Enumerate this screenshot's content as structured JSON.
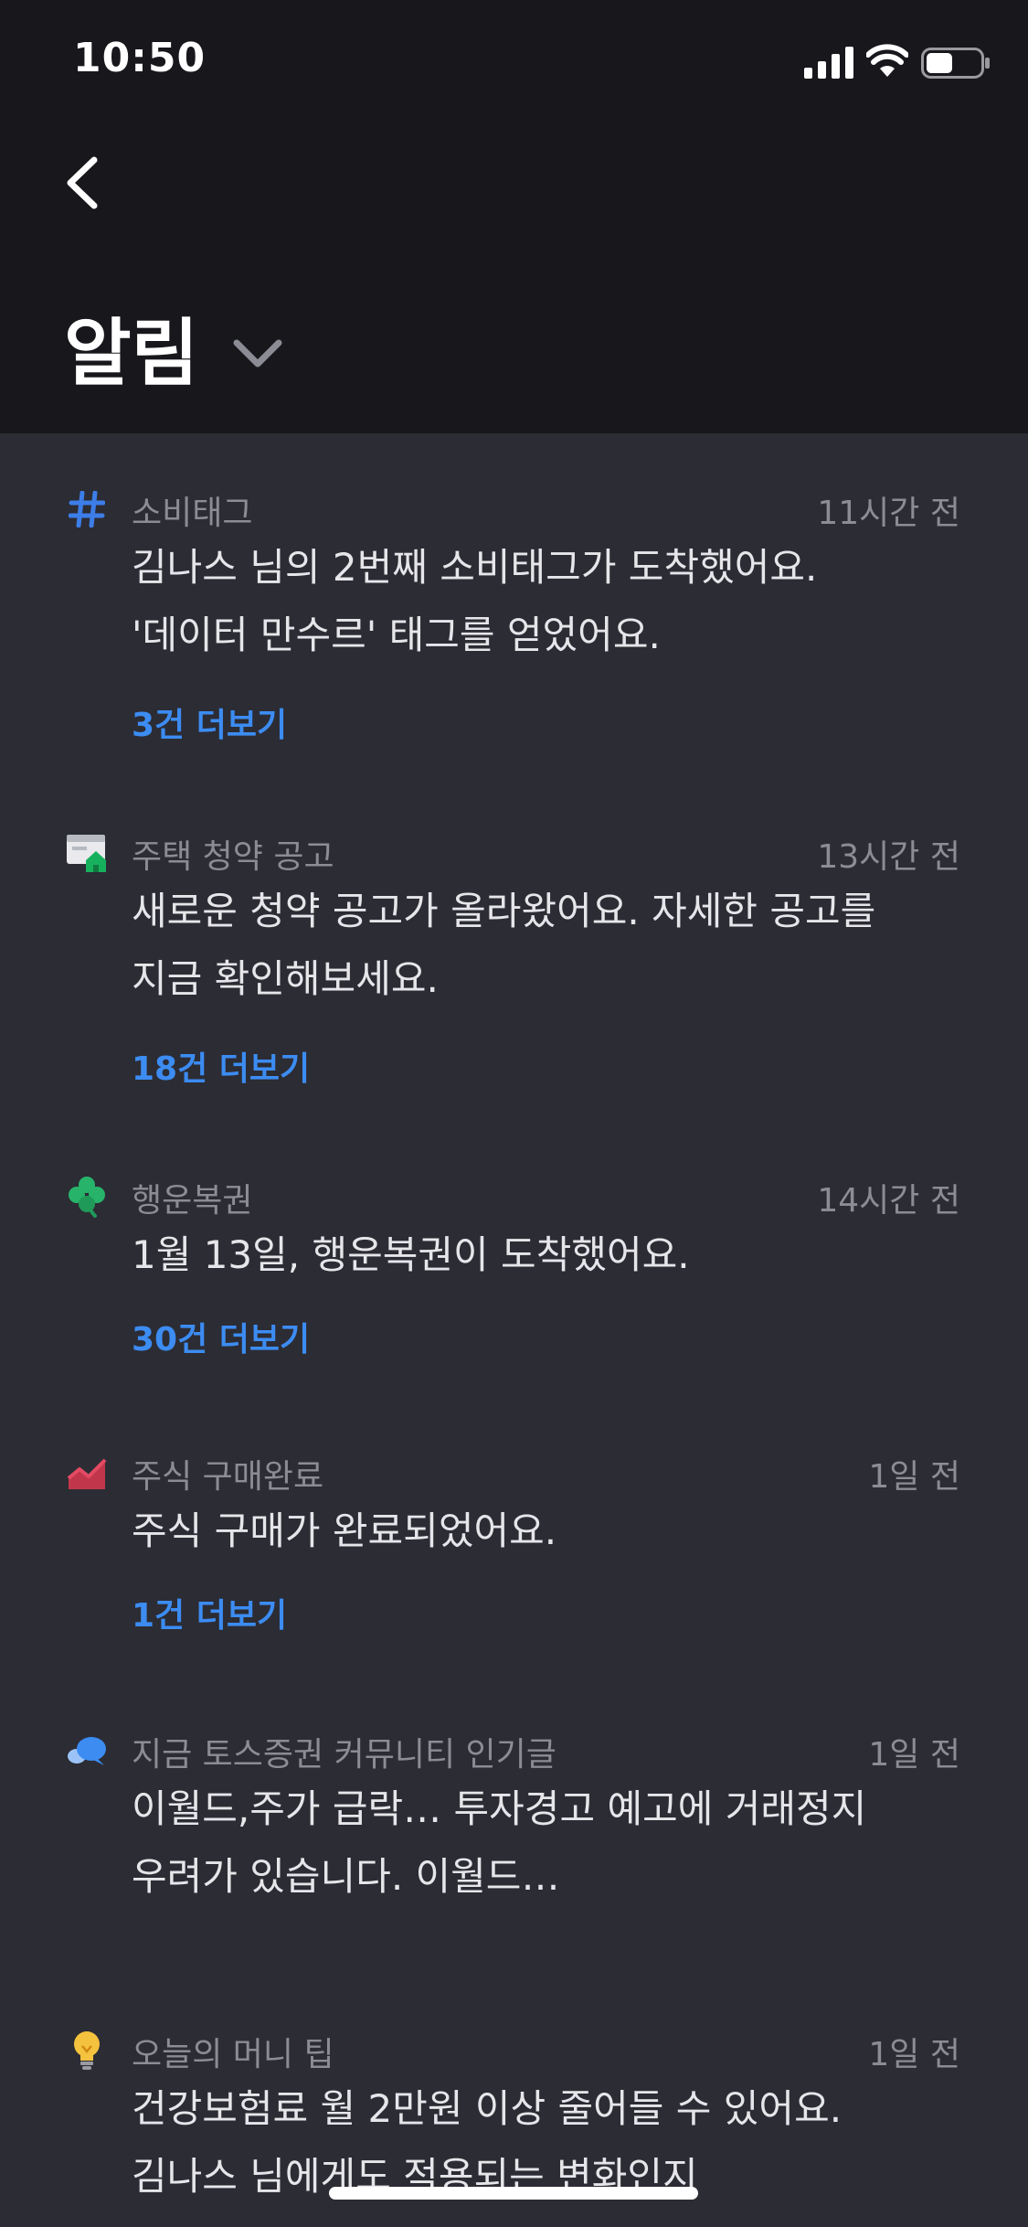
{
  "status_bar": {
    "time": "10:50"
  },
  "header": {
    "back_icon": "chevron-left-icon",
    "title": "알림",
    "dropdown_icon": "chevron-down-icon"
  },
  "colors": {
    "header_bg": "#17171c",
    "feed_bg": "#2c2c34",
    "link": "#3c8cf2",
    "secondary_text": "#8b8c94",
    "primary_text": "#e6e6ea"
  },
  "notifications": [
    {
      "icon": "hashtag-icon",
      "category": "소비태그",
      "time": "11시간 전",
      "lines": [
        "김나스 님의 2번째 소비태그가 도착했어요.",
        "'데이터 만수르' 태그를 얻었어요."
      ],
      "more": "3건 더보기"
    },
    {
      "icon": "housing-notice-icon",
      "category": "주택 청약 공고",
      "time": "13시간 전",
      "lines": [
        "새로운 청약 공고가 올라왔어요. 자세한 공고를",
        "지금 확인해보세요."
      ],
      "more": "18건 더보기"
    },
    {
      "icon": "clover-icon",
      "category": "행운복권",
      "time": "14시간 전",
      "lines": [
        "1월 13일, 행운복권이 도착했어요."
      ],
      "more": "30건 더보기"
    },
    {
      "icon": "stock-chart-icon",
      "category": "주식 구매완료",
      "time": "1일 전",
      "lines": [
        "주식 구매가 완료되었어요."
      ],
      "more": "1건 더보기"
    },
    {
      "icon": "speech-bubbles-icon",
      "category": "지금 토스증권 커뮤니티 인기글",
      "time": "1일 전",
      "lines": [
        "이월드,주가 급락… 투자경고 예고에 거래정지",
        "우려가 있습니다. 이월드…"
      ]
    },
    {
      "icon": "lightbulb-icon",
      "category": "오늘의 머니 팁",
      "time": "1일 전",
      "lines": [
        "건강보험료 월 2만원 이상 줄어들 수 있어요.",
        "김나스 님에게도 적용되는 변화인지"
      ]
    }
  ]
}
